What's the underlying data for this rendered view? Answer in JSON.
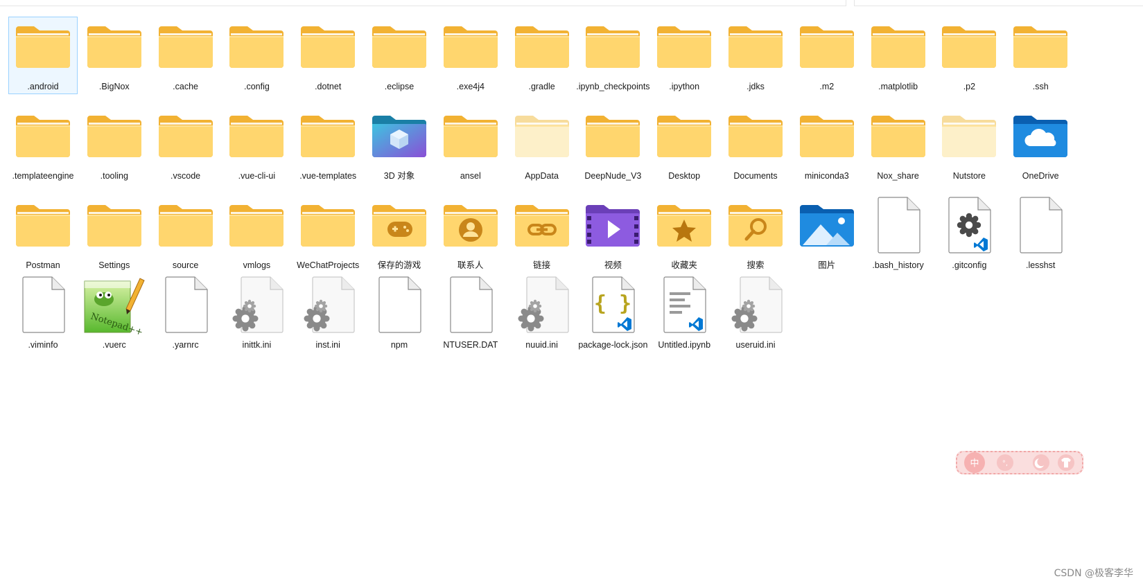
{
  "items": [
    {
      "name": ".android",
      "icon": "folder-icon",
      "selected": true
    },
    {
      "name": ".BigNox",
      "icon": "folder-icon"
    },
    {
      "name": ".cache",
      "icon": "folder-icon"
    },
    {
      "name": ".config",
      "icon": "folder-icon"
    },
    {
      "name": ".dotnet",
      "icon": "folder-icon"
    },
    {
      "name": ".eclipse",
      "icon": "folder-icon"
    },
    {
      "name": ".exe4j4",
      "icon": "folder-icon"
    },
    {
      "name": ".gradle",
      "icon": "folder-icon"
    },
    {
      "name": ".ipynb_checkpoints",
      "icon": "folder-icon"
    },
    {
      "name": ".ipython",
      "icon": "folder-icon"
    },
    {
      "name": ".jdks",
      "icon": "folder-icon"
    },
    {
      "name": ".m2",
      "icon": "folder-icon"
    },
    {
      "name": ".matplotlib",
      "icon": "folder-icon"
    },
    {
      "name": ".p2",
      "icon": "folder-icon"
    },
    {
      "name": ".ssh",
      "icon": "folder-icon"
    },
    {
      "name": ".templateengine",
      "icon": "folder-icon"
    },
    {
      "name": ".tooling",
      "icon": "folder-icon"
    },
    {
      "name": ".vscode",
      "icon": "folder-icon"
    },
    {
      "name": ".vue-cli-ui",
      "icon": "folder-icon"
    },
    {
      "name": ".vue-templates",
      "icon": "folder-icon"
    },
    {
      "name": "3D 对象",
      "icon": "3d-objects-folder-icon"
    },
    {
      "name": "ansel",
      "icon": "folder-icon"
    },
    {
      "name": "AppData",
      "icon": "hidden-folder-icon"
    },
    {
      "name": "DeepNude_V3",
      "icon": "folder-icon"
    },
    {
      "name": "Desktop",
      "icon": "folder-icon"
    },
    {
      "name": "Documents",
      "icon": "folder-icon"
    },
    {
      "name": "miniconda3",
      "icon": "folder-icon"
    },
    {
      "name": "Nox_share",
      "icon": "folder-icon"
    },
    {
      "name": "Nutstore",
      "icon": "hidden-folder-icon"
    },
    {
      "name": "OneDrive",
      "icon": "onedrive-folder-icon"
    },
    {
      "name": "Postman",
      "icon": "folder-icon"
    },
    {
      "name": "Settings",
      "icon": "folder-icon"
    },
    {
      "name": "source",
      "icon": "folder-icon"
    },
    {
      "name": "vmlogs",
      "icon": "folder-icon"
    },
    {
      "name": "WeChatProjects",
      "icon": "folder-icon"
    },
    {
      "name": "保存的游戏",
      "icon": "saved-games-folder-icon"
    },
    {
      "name": "联系人",
      "icon": "contacts-folder-icon"
    },
    {
      "name": "链接",
      "icon": "links-folder-icon"
    },
    {
      "name": "视频",
      "icon": "videos-folder-icon"
    },
    {
      "name": "收藏夹",
      "icon": "favorites-folder-icon"
    },
    {
      "name": "搜索",
      "icon": "searches-folder-icon"
    },
    {
      "name": "图片",
      "icon": "pictures-folder-icon"
    },
    {
      "name": ".bash_history",
      "icon": "blank-file-icon"
    },
    {
      "name": ".gitconfig",
      "icon": "vscode-settings-file-icon"
    },
    {
      "name": ".lesshst",
      "icon": "blank-file-icon"
    },
    {
      "name": ".viminfo",
      "icon": "blank-file-icon"
    },
    {
      "name": ".vuerc",
      "icon": "notepad-plus-plus-file-icon"
    },
    {
      "name": ".yarnrc",
      "icon": "blank-file-icon"
    },
    {
      "name": "inittk.ini",
      "icon": "ini-settings-file-icon"
    },
    {
      "name": "inst.ini",
      "icon": "ini-settings-file-icon"
    },
    {
      "name": "npm",
      "icon": "blank-file-icon"
    },
    {
      "name": "NTUSER.DAT",
      "icon": "blank-file-icon"
    },
    {
      "name": "nuuid.ini",
      "icon": "ini-settings-file-icon"
    },
    {
      "name": "package-lock.json",
      "icon": "vscode-json-file-icon"
    },
    {
      "name": "Untitled.ipynb",
      "icon": "vscode-ipynb-file-icon"
    },
    {
      "name": "useruid.ini",
      "icon": "ini-settings-file-icon"
    }
  ],
  "ime_toolbar": {
    "mode_label": "中",
    "punct_label": "°,"
  },
  "watermark": "CSDN @极客李华",
  "colors": {
    "folder_back": "#f2b233",
    "folder_front": "#ffd66e",
    "selection_border": "#99d1ff",
    "vscode_blue": "#0078d4"
  }
}
